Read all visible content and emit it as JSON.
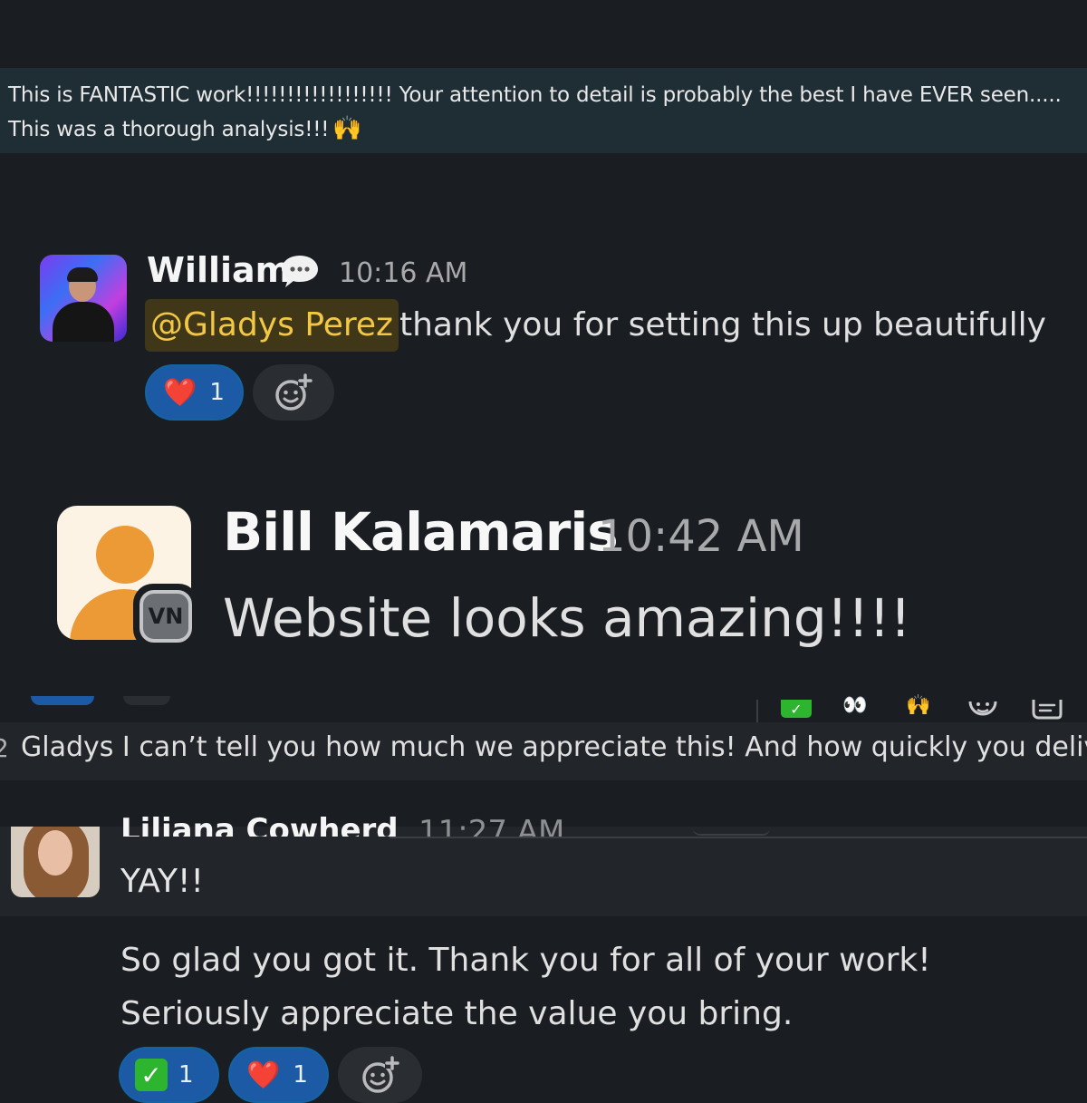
{
  "banner": {
    "text": "This is FANTASTIC work!!!!!!!!!!!!!!!!!! Your attention to detail is probably the best I have EVER seen..... This was a thorough analysis!!!",
    "emoji": "🙌"
  },
  "william": {
    "name": "William",
    "time": "10:16 AM",
    "mention": "@Gladys Perez",
    "message": "thank you for setting this up beautifully",
    "reactions": [
      {
        "emoji": "❤️",
        "count": "1"
      }
    ]
  },
  "bill": {
    "name": "Bill Kalamaris",
    "time": "10:42 AM",
    "badge": "VN",
    "message": "Website looks amazing!!!!"
  },
  "toolbar": {
    "icons": [
      "check-mark",
      "eyes",
      "raised-hands",
      "add-reaction",
      "reply-in-thread"
    ],
    "check_glyph": "✓",
    "eyes_glyph": "👀",
    "hands_glyph": "🙌"
  },
  "appreciate": {
    "cut_prefix": "2",
    "text": "Gladys I can’t tell you how much we appreciate this! And how quickly you delivered"
  },
  "liliana": {
    "name": "Liliana Cowherd",
    "time": "11:27 AM",
    "message1": "YAY!!",
    "message2": "So glad you got it. Thank you for all of your work! Seriously appreciate the value you bring.",
    "reactions": [
      {
        "emoji": "✓",
        "count": "1"
      },
      {
        "emoji": "❤️",
        "count": "1"
      }
    ]
  }
}
